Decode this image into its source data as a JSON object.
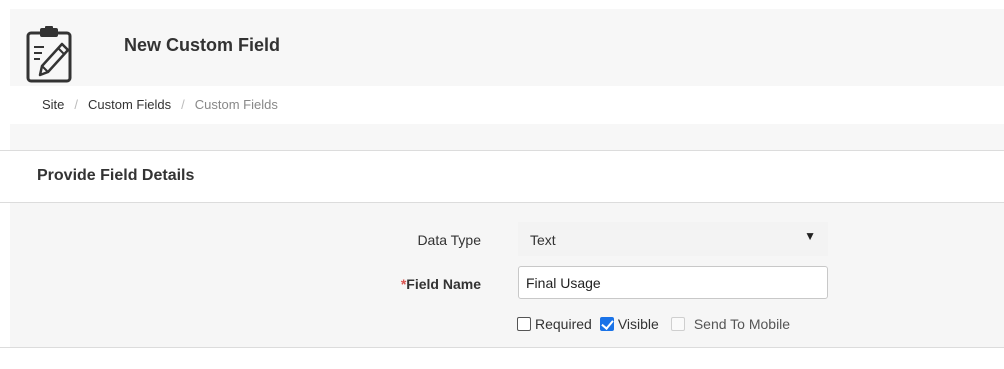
{
  "header": {
    "title": "New Custom Field",
    "icon": "clipboard-edit-icon"
  },
  "breadcrumb": {
    "items": [
      "Site",
      "Custom Fields",
      "Custom Fields"
    ],
    "separator": "/"
  },
  "section": {
    "title": "Provide Field Details"
  },
  "form": {
    "data_type": {
      "label": "Data Type",
      "value": "Text",
      "caret": "▼"
    },
    "field_name": {
      "required_marker": "*",
      "label": "Field Name",
      "value": "Final Usage"
    },
    "checkboxes": [
      {
        "label": "Required",
        "checked": false,
        "disabled": false
      },
      {
        "label": "Visible",
        "checked": true,
        "disabled": false
      },
      {
        "label": "Send To Mobile",
        "checked": false,
        "disabled": true
      }
    ]
  },
  "colors": {
    "accent": "#1a73e8",
    "required": "#d9534f"
  }
}
